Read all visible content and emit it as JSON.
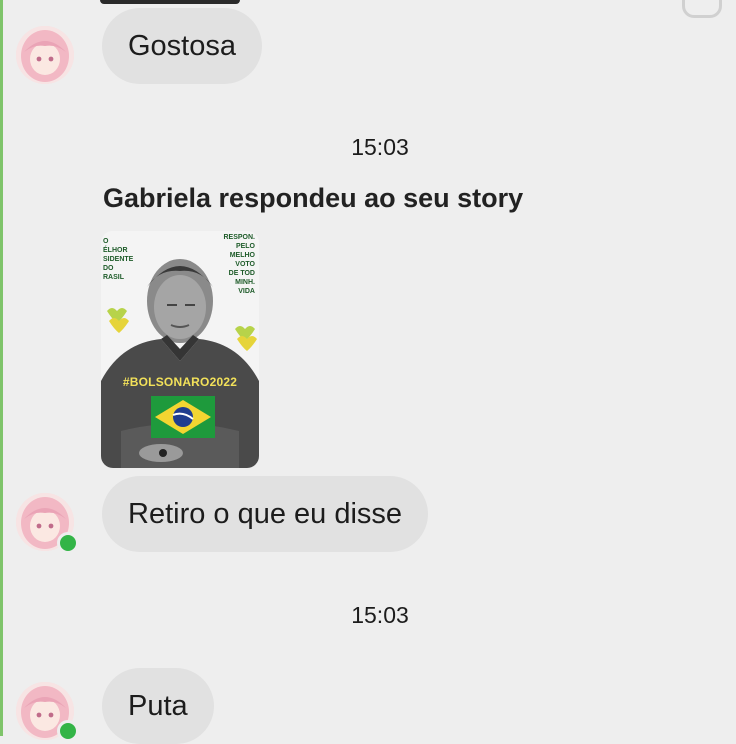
{
  "messages": {
    "first": "Gostosa",
    "second": "Retiro o que eu disse",
    "third": "Puta"
  },
  "timestamps": [
    "15:03",
    "15:03"
  ],
  "reply_notice": "Gabriela respondeu ao seu story",
  "story": {
    "left_text": "O\nÉLHOR\nSIDENTE\nDO\nRASIL",
    "right_text": "RESPON.\nPELO\nMELHO\nVOTO\nDE TOD\nMINH.\nVIDA",
    "hashtag": "#BOLSONARO2022"
  },
  "colors": {
    "background": "#eeeeee",
    "bubble": "#e1e1e1",
    "online": "#33b447",
    "accent_left": "#7fc46a"
  }
}
